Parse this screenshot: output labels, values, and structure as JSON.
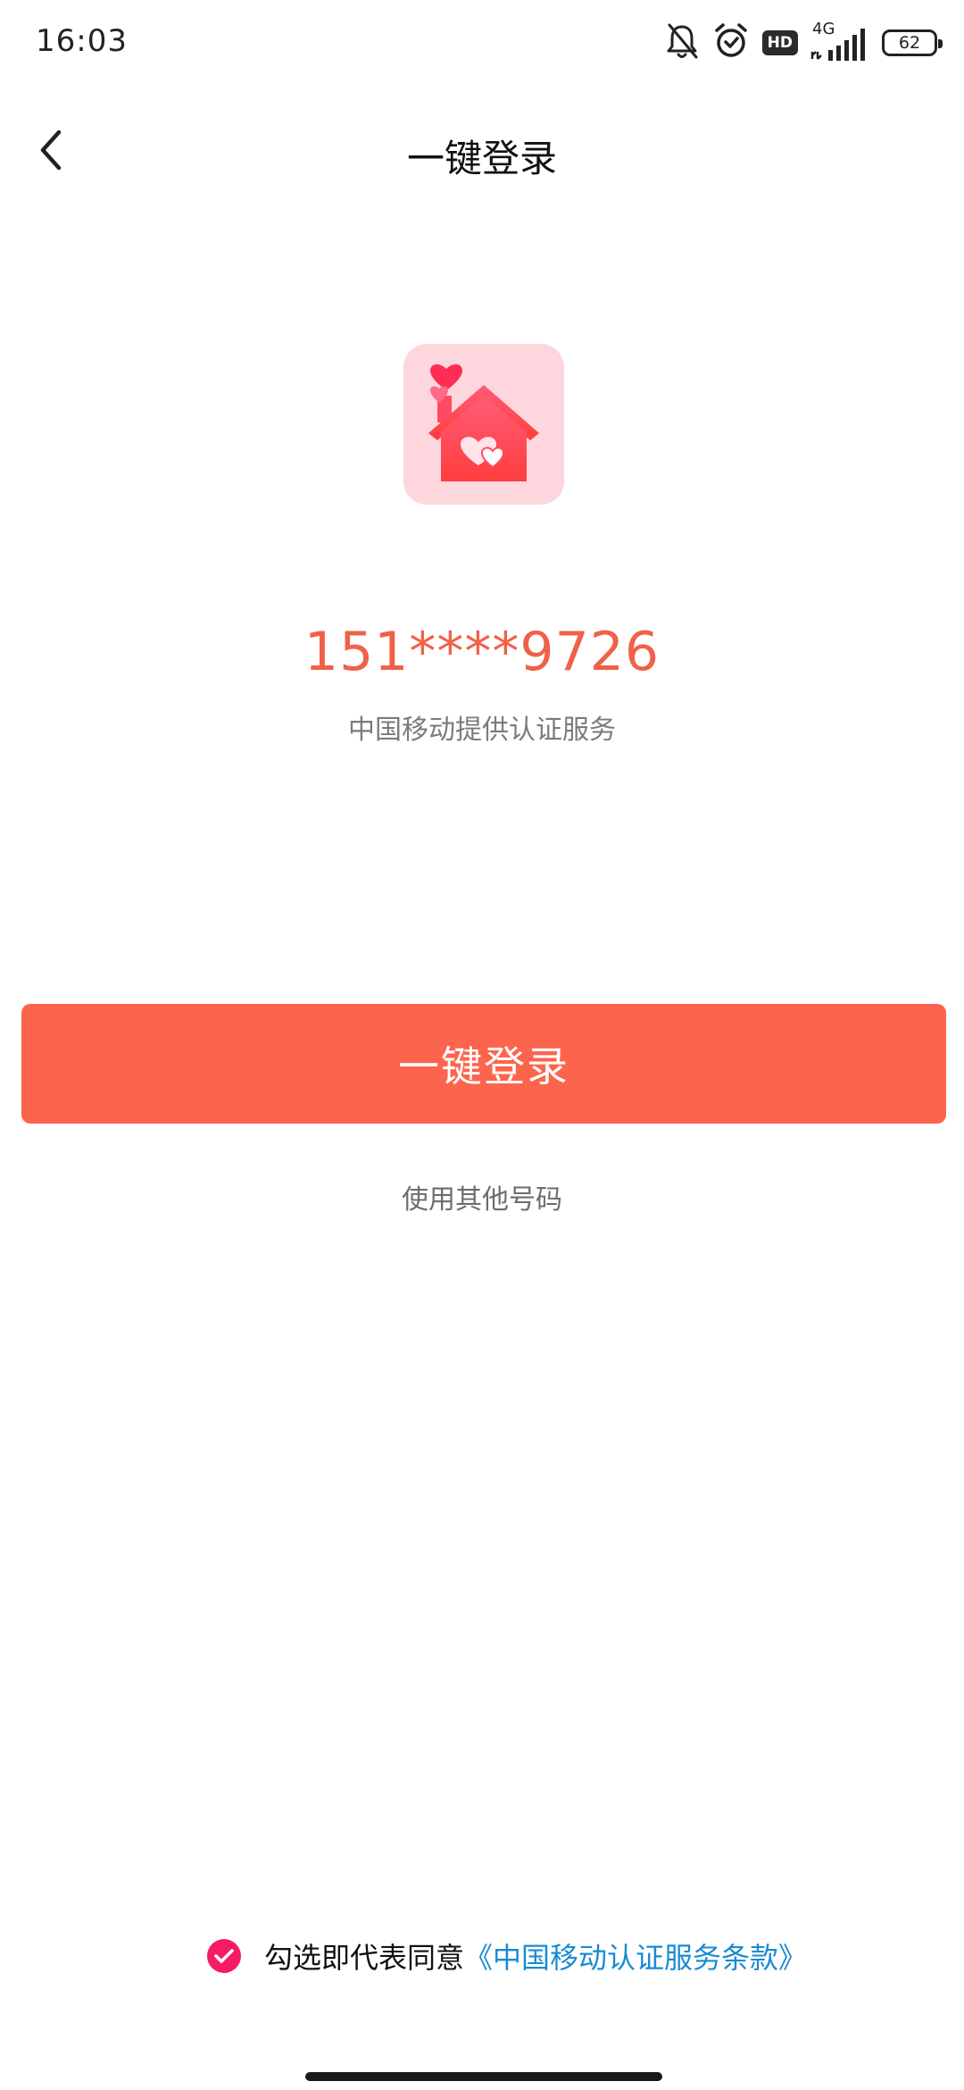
{
  "status_bar": {
    "time": "16:03",
    "hd_label": "HD",
    "network_label": "4G",
    "battery_level": "62"
  },
  "nav": {
    "title": "一键登录"
  },
  "login": {
    "masked_phone": "151****9726",
    "provider_text": "中国移动提供认证服务",
    "login_button": "一键登录",
    "other_number": "使用其他号码"
  },
  "agreement": {
    "checked": true,
    "prefix": "勾选即代表同意",
    "link_text": "《中国移动认证服务条款》"
  },
  "colors": {
    "accent": "#fd644d",
    "phone_text": "#f0614a",
    "link": "#1a8bd1",
    "checkbox": "#f51c63",
    "logo_bg": "#fed6de"
  }
}
